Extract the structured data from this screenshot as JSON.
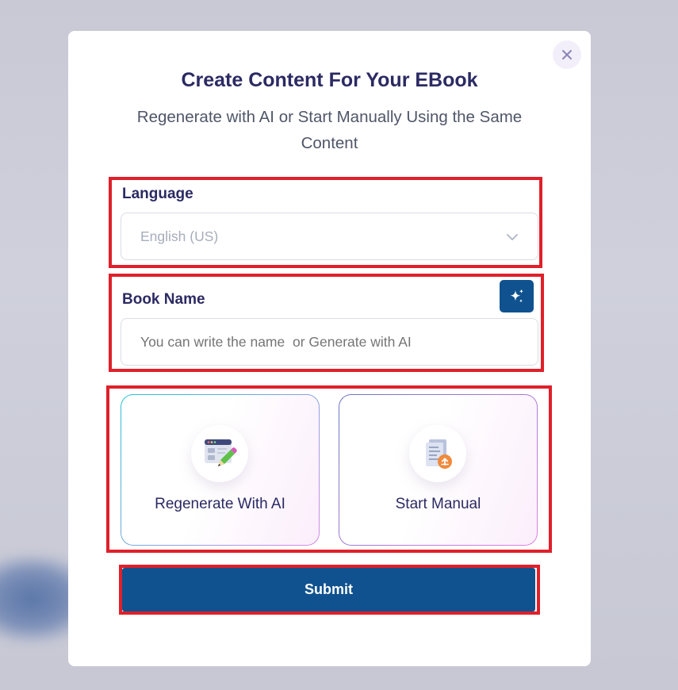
{
  "modal": {
    "title": "Create Content For Your EBook",
    "subtitle": "Regenerate with AI or Start Manually Using the Same Content",
    "close_icon": "close-icon"
  },
  "language": {
    "label": "Language",
    "selected": "English (US)",
    "icon": "chevron-down-icon"
  },
  "book_name": {
    "label": "Book Name",
    "placeholder": "You can write the name  or Generate with AI",
    "ai_button_icon": "sparkles-icon"
  },
  "options": [
    {
      "label": "Regenerate With AI",
      "icon": "ai-edit-document-icon"
    },
    {
      "label": "Start Manual",
      "icon": "document-upload-icon"
    }
  ],
  "submit_label": "Submit",
  "colors": {
    "primary": "#10528f",
    "heading": "#2b2a63",
    "highlight": "#e0202a"
  }
}
